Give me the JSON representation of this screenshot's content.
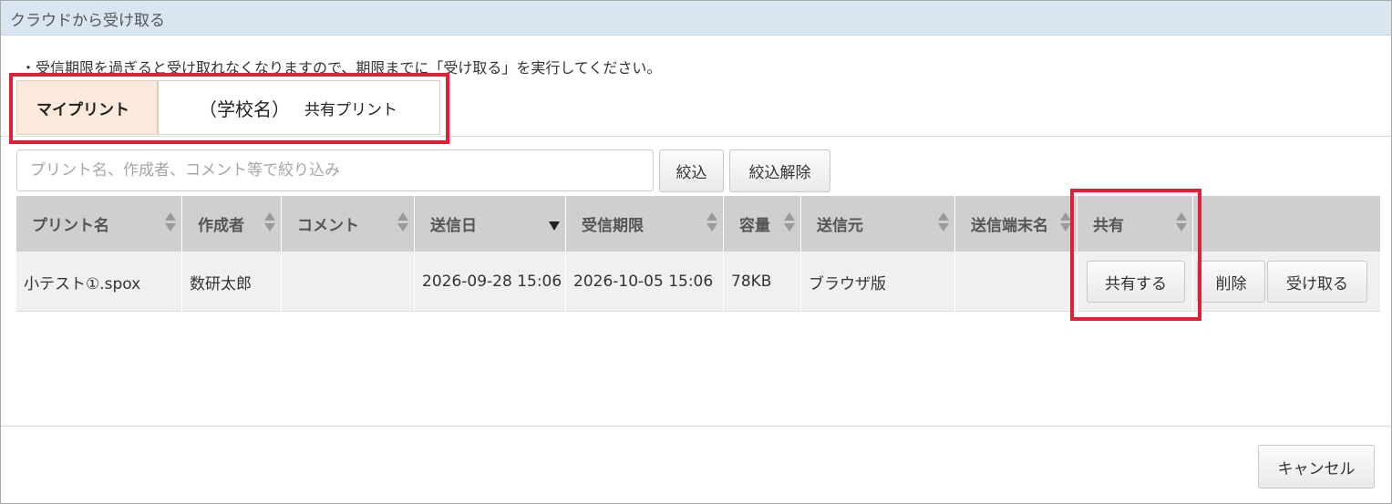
{
  "window": {
    "title": "クラウドから受け取る"
  },
  "notice": "・受信期限を過ぎると受け取れなくなりますので、期限までに「受け取る」を実行してください。",
  "tabs": [
    {
      "label": "マイプリント",
      "active": true
    },
    {
      "school": "（学校名）",
      "label": "共有プリント",
      "active": false
    }
  ],
  "search": {
    "placeholder": "プリント名、作成者、コメント等で絞り込み",
    "value": ""
  },
  "filter": {
    "apply_label": "絞込",
    "clear_label": "絞込解除"
  },
  "table": {
    "columns": [
      "プリント名",
      "作成者",
      "コメント",
      "送信日",
      "受信期限",
      "容量",
      "送信元",
      "送信端末名",
      "共有"
    ],
    "sorted_column": "送信日",
    "rows": [
      {
        "name": "小テスト①.spox",
        "author": "数研太郎",
        "comment": "",
        "sent": "2026-09-28 15:06",
        "deadline": "2026-10-05 15:06",
        "size": "78KB",
        "source": "ブラウザ版",
        "device": "",
        "share_label": "共有する",
        "delete_label": "削除",
        "receive_label": "受け取る"
      }
    ]
  },
  "footer": {
    "cancel_label": "キャンセル"
  },
  "colors": {
    "titlebar": "#d9e6f1",
    "active_tab": "#fbeadb",
    "highlight": "#e02036",
    "table_header": "#cfcfcf"
  },
  "icons": [
    "sort-icon",
    "sort-desc-icon"
  ]
}
